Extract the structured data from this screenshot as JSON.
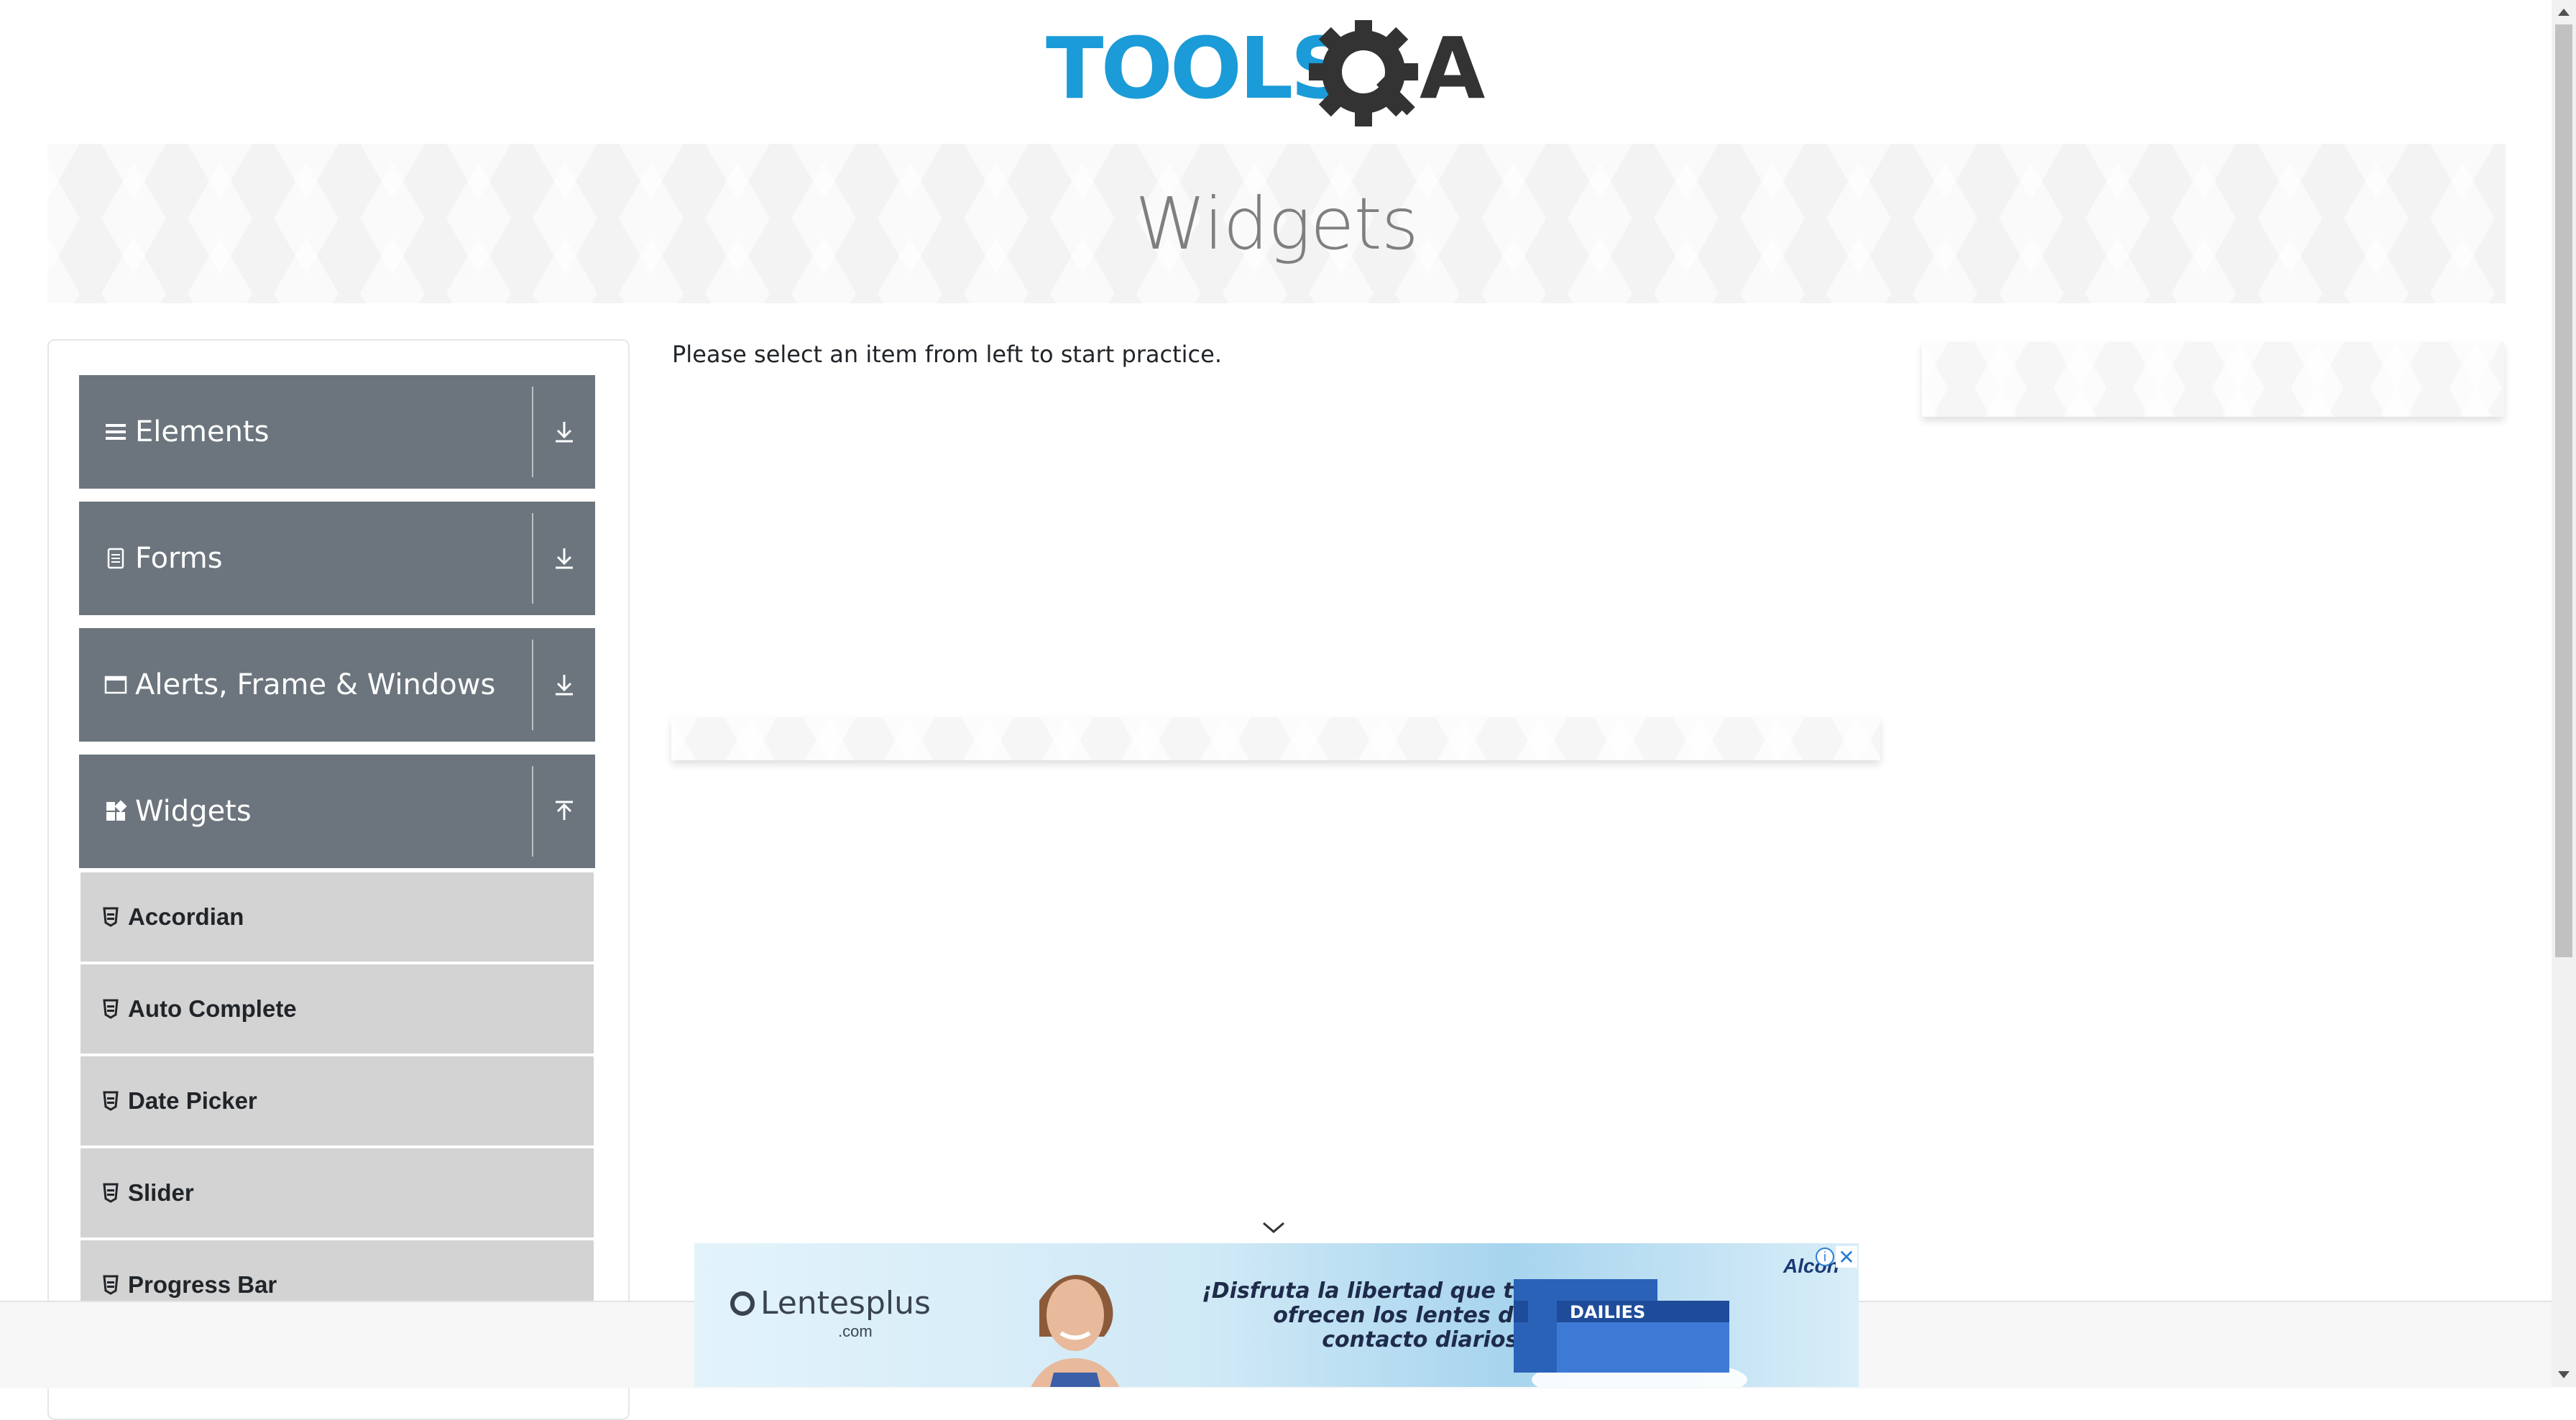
{
  "header": {
    "logo_text_blue": "TOOLS",
    "logo_text_dark": "A"
  },
  "banner": {
    "title": "Widgets"
  },
  "sidebar": {
    "groups": [
      {
        "label": "Elements",
        "icon": "hamburger-icon",
        "expanded": false
      },
      {
        "label": "Forms",
        "icon": "document-icon",
        "expanded": false
      },
      {
        "label": "Alerts, Frame & Windows",
        "icon": "window-icon",
        "expanded": false
      },
      {
        "label": "Widgets",
        "icon": "grid-icon",
        "expanded": true
      }
    ],
    "widgets_items": [
      {
        "label": "Accordian"
      },
      {
        "label": "Auto Complete"
      },
      {
        "label": "Date Picker"
      },
      {
        "label": "Slider"
      },
      {
        "label": "Progress Bar"
      }
    ]
  },
  "main": {
    "intro_text": "Please select an item from left to start practice."
  },
  "ad": {
    "brand_name": "Lentesplus",
    "brand_domain": ".com",
    "headline_lines": [
      "¡Disfruta la libertad que te",
      "ofrecen los lentes de",
      "contacto diarios!"
    ],
    "maker": "Alcon",
    "product_name": "DAILIES",
    "info_symbol": "i",
    "close_symbol": "✕"
  },
  "colors": {
    "logo_blue": "#1b9bd7",
    "logo_dark": "#333333",
    "header_bg": "#6c757d",
    "item_bg": "#d3d3d3"
  }
}
